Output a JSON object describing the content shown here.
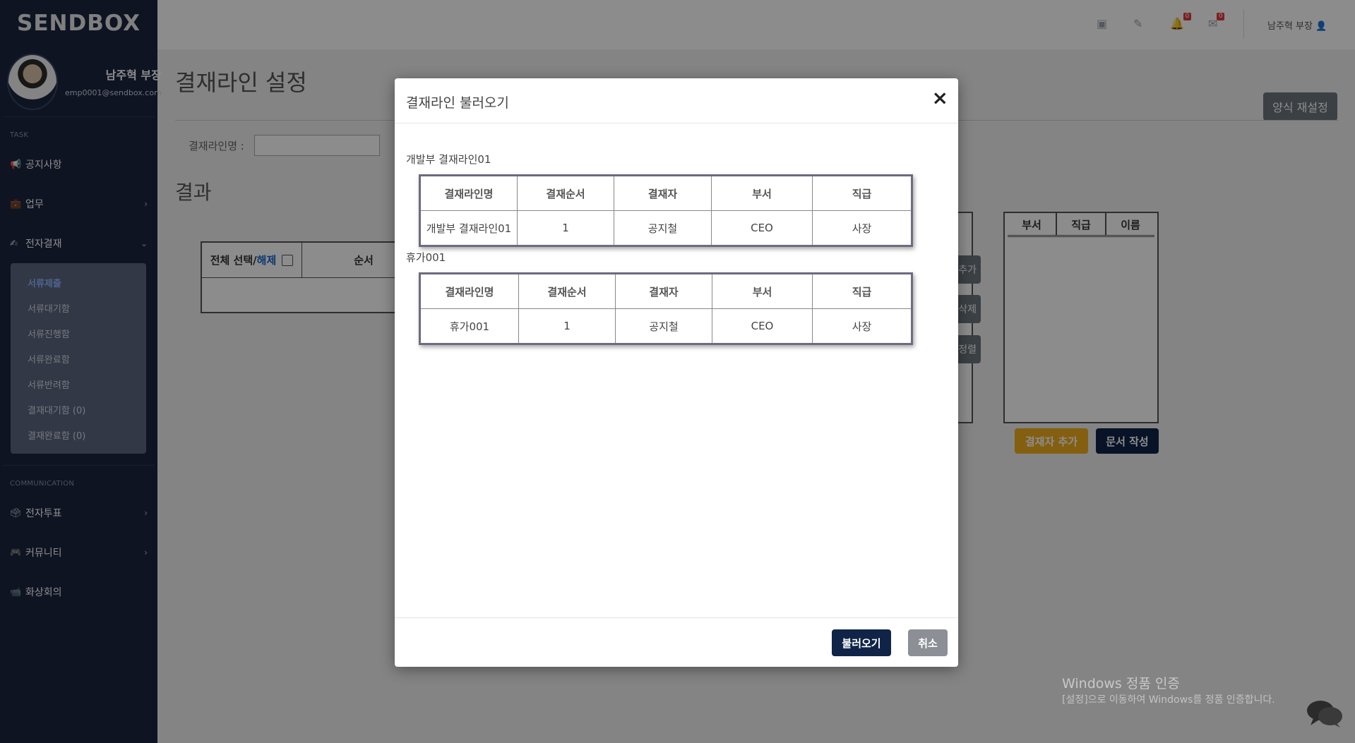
{
  "brand": "SENDBOX",
  "profile": {
    "name": "남주혁 부장",
    "email": "emp0001@sendbox.com"
  },
  "sidebar": {
    "task_label": "TASK",
    "communication_label": "COMMUNICATION",
    "items": [
      {
        "label": "공지사항",
        "icon": "megaphone-icon"
      },
      {
        "label": "업무",
        "icon": "briefcase-icon"
      },
      {
        "label": "전자결재",
        "icon": "signature-icon"
      }
    ],
    "submenu": [
      "서류제출",
      "서류대기함",
      "서류진행함",
      "서류완료함",
      "서류반려함",
      "결재대기함 (0)",
      "결재완료함 (0)"
    ],
    "comm_items": [
      {
        "label": "전자투표",
        "icon": "vote-icon"
      },
      {
        "label": "커뮤니티",
        "icon": "gamepad-icon"
      },
      {
        "label": "화상회의",
        "icon": "video-icon"
      }
    ]
  },
  "header": {
    "notif_count": "0",
    "mail_count": "0",
    "user": "남주혁 부장"
  },
  "page": {
    "title": "결재라인 설정",
    "reset_button": "양식 재설정",
    "line_name_label": "결재라인명 :",
    "result_title": "결과",
    "select_all": "전체 선택/",
    "deselect": "해제",
    "order_col": "순서",
    "right_cols": [
      "부서",
      "직급",
      "이름"
    ],
    "mid_buttons": [
      "추가",
      "삭제",
      "정렬"
    ],
    "add_approver": "결재자 추가",
    "write_doc": "문서 작성"
  },
  "modal": {
    "title": "결재라인 불러오기",
    "close": "×",
    "columns": [
      "결재라인명",
      "결재순서",
      "결재자",
      "부서",
      "직급"
    ],
    "groups": [
      {
        "label": "개발부 결재라인01",
        "rows": [
          [
            "개발부 결재라인01",
            "1",
            "공지철",
            "CEO",
            "사장"
          ]
        ]
      },
      {
        "label": "휴가001",
        "rows": [
          [
            "휴가001",
            "1",
            "공지철",
            "CEO",
            "사장"
          ]
        ]
      }
    ],
    "load_button": "불러오기",
    "cancel_button": "취소"
  },
  "watermark": {
    "line1": "Windows 정품 인증",
    "line2": "[설정]으로 이동하여 Windows를 정품 인증합니다."
  }
}
